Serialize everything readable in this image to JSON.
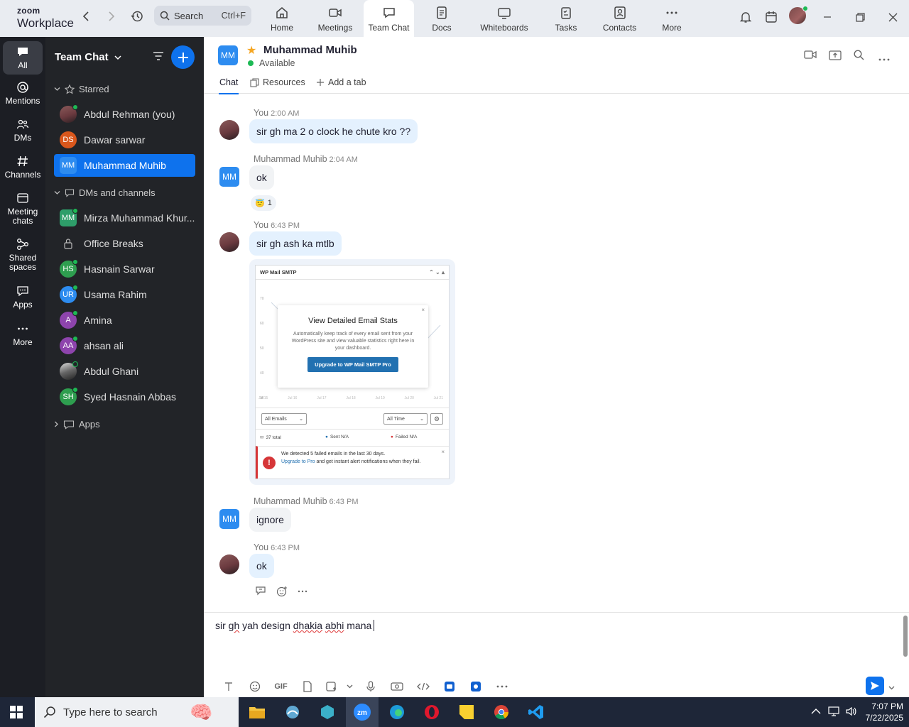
{
  "app": {
    "logo_top": "zoom",
    "logo_bottom": "Workplace",
    "search_label": "Search",
    "search_shortcut": "Ctrl+F",
    "tabs": [
      {
        "label": "Home",
        "icon": "home-icon"
      },
      {
        "label": "Meetings",
        "icon": "video-icon"
      },
      {
        "label": "Team Chat",
        "icon": "chat-icon",
        "active": true
      },
      {
        "label": "Docs",
        "icon": "docs-icon"
      },
      {
        "label": "Whiteboards",
        "icon": "whiteboard-icon"
      },
      {
        "label": "Tasks",
        "icon": "tasks-icon"
      },
      {
        "label": "Contacts",
        "icon": "contacts-icon"
      },
      {
        "label": "More",
        "icon": "more-icon"
      }
    ]
  },
  "rail": {
    "items": [
      {
        "label": "All",
        "icon": "chat-bubble-icon",
        "active": true
      },
      {
        "label": "Mentions",
        "icon": "at-icon"
      },
      {
        "label": "DMs",
        "icon": "people-icon"
      },
      {
        "label": "Channels",
        "icon": "hash-icon"
      },
      {
        "label": "Meeting chats",
        "icon": "calendar-icon"
      },
      {
        "label": "Shared spaces",
        "icon": "shared-spaces-icon"
      },
      {
        "label": "Apps",
        "icon": "apps-icon"
      },
      {
        "label": "More",
        "icon": "more-icon"
      }
    ]
  },
  "sidebar": {
    "title": "Team Chat",
    "starred_label": "Starred",
    "starred": [
      {
        "name": "Abdul Rehman (you)",
        "initials": "",
        "color": "#7a4a4a",
        "online": true
      },
      {
        "name": "Dawar sarwar",
        "initials": "DS",
        "color": "#d9571c",
        "online": false
      },
      {
        "name": "Muhammad Muhib",
        "initials": "MM",
        "color": "#2d8cf0",
        "online": true,
        "selected": true
      }
    ],
    "dms_label": "DMs and channels",
    "dms": [
      {
        "name": "Mirza Muhammad Khur...",
        "initials": "MM",
        "color": "#2e9e6a",
        "online": true
      },
      {
        "name": "Office Breaks",
        "initials": "",
        "color": "",
        "online": false
      },
      {
        "name": "Hasnain Sarwar",
        "initials": "HS",
        "color": "#2e9e4f",
        "online": true
      },
      {
        "name": "Usama Rahim",
        "initials": "UR",
        "color": "#2d8cf0",
        "online": true
      },
      {
        "name": "Amina",
        "initials": "A",
        "color": "#8e44ad",
        "online": true
      },
      {
        "name": "ahsan ali",
        "initials": "AA",
        "color": "#8e44ad",
        "online": true
      },
      {
        "name": "Abdul Ghani",
        "initials": "",
        "color": "#555",
        "online": true
      },
      {
        "name": "Syed Hasnain Abbas",
        "initials": "SH",
        "color": "#2e9e4f",
        "online": true
      }
    ],
    "apps_label": "Apps"
  },
  "chat": {
    "contact_name": "Muhammad Muhib",
    "contact_initials": "MM",
    "status": "Available",
    "subtabs": [
      "Chat",
      "Resources",
      "Add a tab"
    ],
    "messages": [
      {
        "sender": "You",
        "time": "2:00 AM",
        "text": "sir gh ma 2 o clock he chute kro ??"
      },
      {
        "sender": "Muhammad Muhib",
        "time": "2:04 AM",
        "text": "ok",
        "reaction": "😇",
        "reaction_count": "1"
      },
      {
        "sender": "You",
        "time": "6:43 PM",
        "text": "sir gh ash ka mtlb"
      },
      {
        "sender": "Muhammad Muhib",
        "time": "6:43 PM",
        "text": "ignore"
      },
      {
        "sender": "You",
        "time": "6:43 PM",
        "text": "ok"
      }
    ],
    "attachment": {
      "header": "WP Mail SMTP",
      "popup_title": "View Detailed Email Stats",
      "popup_text": "Automatically keep track of every email sent from your WordPress site and view valuable statistics right here in your dashboard.",
      "popup_button": "Upgrade to WP Mail SMTP Pro",
      "filter_left": "All Emails",
      "filter_right": "All Time",
      "stat_total": "37 total",
      "stat_sent": "Sent N/A",
      "stat_failed": "Failed N/A",
      "alert_text": "We detected 5 failed emails in the last 30 days.",
      "alert_link": "Upgrade to Pro",
      "alert_rest": "and get instant alert notifications when they fail.",
      "y_ticks": [
        "70",
        "60",
        "50",
        "40",
        "30"
      ],
      "x_ticks": [
        "Jul 15",
        "Jul 16",
        "Jul 17",
        "Jul 18",
        "Jul 19",
        "Jul 20",
        "Jul 21"
      ]
    },
    "composer": {
      "prefix": "sir ",
      "w1": "gh",
      "mid1": " yah design ",
      "w2": "dhakia",
      "mid2": " ",
      "w3": "abhi",
      "suffix": " mana",
      "gif_label": "GIF"
    }
  },
  "taskbar": {
    "search_placeholder": "Type here to search",
    "time": "7:07 PM",
    "date": "7/22/2025"
  },
  "colors": {
    "accent": "#0e72ed",
    "online": "#1db954",
    "rail_bg": "#1c1e24",
    "sidebar_bg": "#222428"
  }
}
